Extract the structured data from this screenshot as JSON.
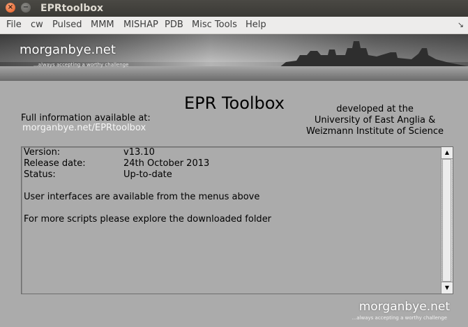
{
  "window": {
    "title": "EPRtoolbox",
    "close_glyph": "×",
    "minimize_glyph": "−"
  },
  "menubar": {
    "items": [
      "File",
      "cw",
      "Pulsed",
      "MMM",
      "MISHAP",
      "PDB",
      "Misc Tools",
      "Help"
    ],
    "overflow_glyph": "↘"
  },
  "banner": {
    "brand": "morganbye.net",
    "tagline": "...always accepting a worthy challenge"
  },
  "main": {
    "title": "EPR Toolbox",
    "info_label": "Full information available at:",
    "info_link": "morganbye.net/EPRtoolbox",
    "developed": {
      "line1": "developed at the",
      "line2": "University of East Anglia &",
      "line3": "Weizmann Institute of Science"
    }
  },
  "panel": {
    "rows": [
      {
        "key": "Version:",
        "value": "v13.10"
      },
      {
        "key": "Release date:",
        "value": "24th October 2013"
      },
      {
        "key": "Status:",
        "value": "Up-to-date"
      }
    ],
    "line1": "User interfaces are available from the menus above",
    "line2": "For more scripts please explore the downloaded folder",
    "scroll_up_glyph": "▲",
    "scroll_down_glyph": "▼"
  },
  "footer": {
    "brand": "morganbye.net",
    "tagline": "...always accepting a worthy challenge"
  },
  "colors": {
    "background": "#ababab",
    "titlebar": "#3c3b37",
    "menubar": "#edeceb",
    "close_button": "#e3571c"
  }
}
